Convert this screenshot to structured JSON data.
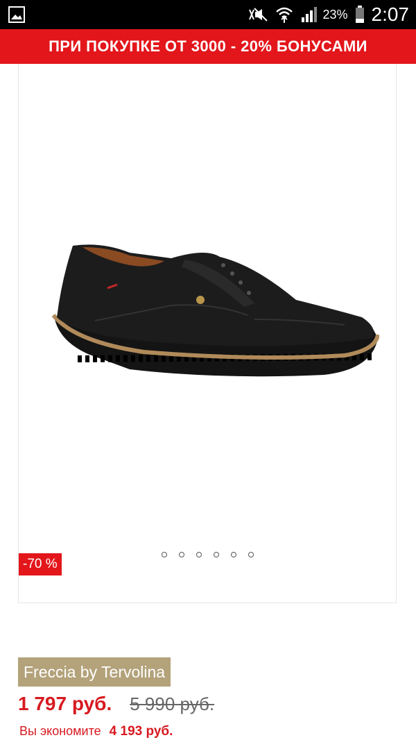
{
  "status_bar": {
    "battery_percent": "23%",
    "time": "2:07",
    "icons": [
      "gallery-notification-icon",
      "mute-icon",
      "wifi-icon",
      "signal-icon",
      "battery-icon"
    ]
  },
  "promo": {
    "text": "ПРИ ПОКУПКЕ ОТ 3000 - 20% БОНУСАМИ",
    "color": "#e3161b"
  },
  "gallery": {
    "discount_badge": "-70 %",
    "dots_count": 6
  },
  "product": {
    "brand": "Freccia by Tervolina",
    "price": "1 797 руб.",
    "old_price": "5 990 руб.",
    "savings_label": "Вы экономите",
    "savings_amount": "4 193 руб.",
    "brand_color": "#b3a27a",
    "price_color": "#d71920"
  }
}
